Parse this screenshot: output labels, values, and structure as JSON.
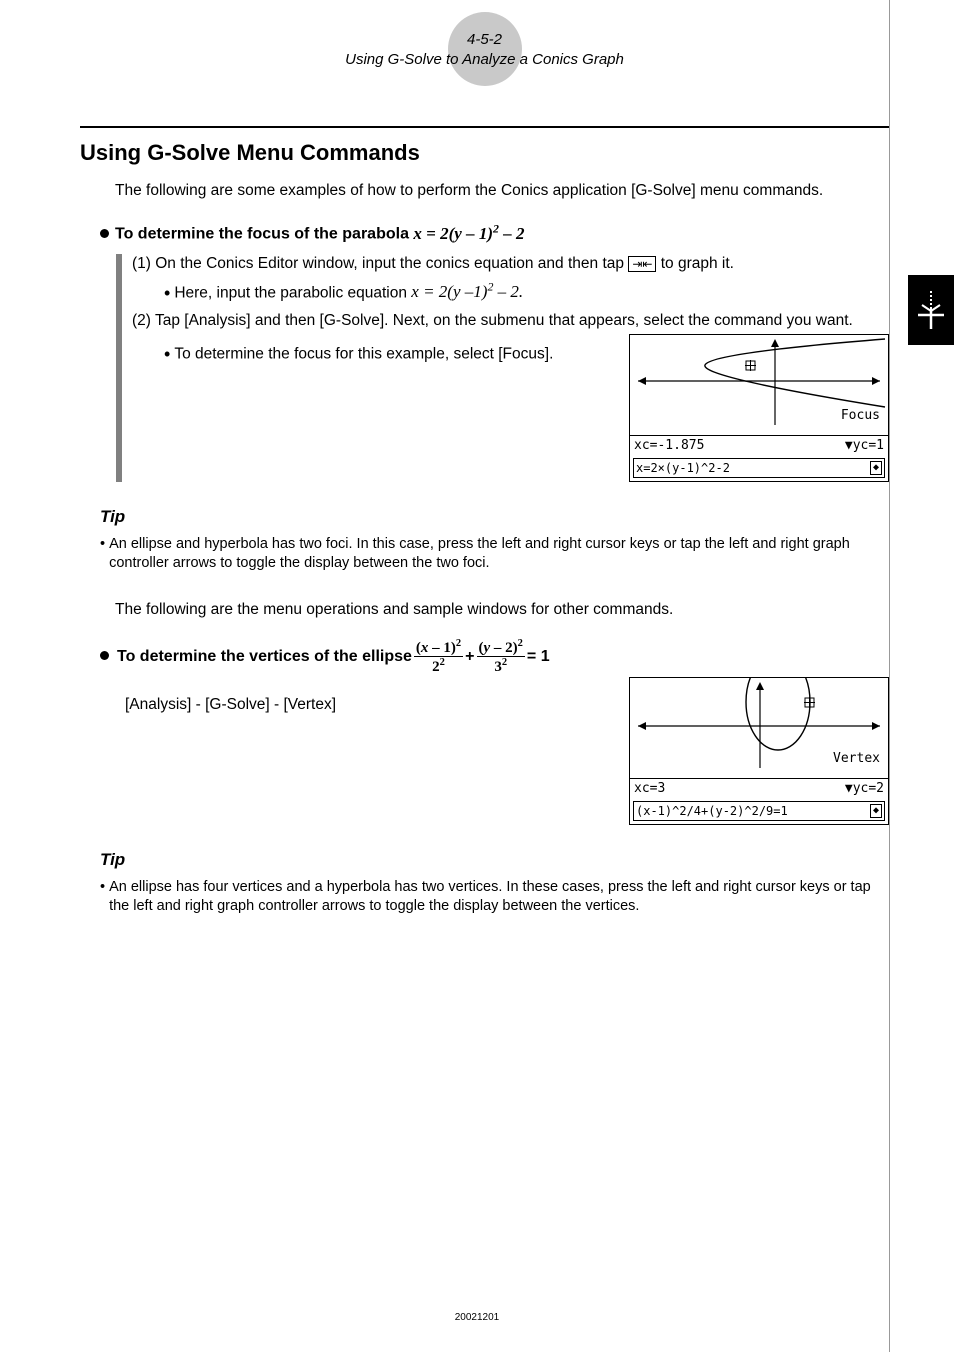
{
  "header": {
    "pagecode": "4-5-2",
    "subtitle": "Using G-Solve to Analyze a Conics Graph"
  },
  "section_title": "Using G-Solve Menu Commands",
  "intro": "The following are some examples of how to perform the Conics application [G-Solve] menu commands.",
  "ex1": {
    "heading_prefix": "To determine the focus of the parabola ",
    "heading_eq": "x = 2(y – 1)² – 2",
    "step1": "(1) On the Conics Editor window, input the conics equation and then tap ",
    "step1_suffix": " to graph it.",
    "step1_sub_prefix": "Here, input the parabolic equation ",
    "step1_sub_eq": "x = 2(y –1)² – 2.",
    "step2": "(2) Tap [Analysis] and then [G-Solve]. Next, on the submenu that appears, select the command you want.",
    "step2_sub": "To determine the focus for this example, select [Focus].",
    "screenshot": {
      "label": "Focus",
      "xc": "xc=-1.875",
      "yc": "yc=1",
      "eq": "x=2×(y-1)^2-2"
    }
  },
  "tip1": {
    "label": "Tip",
    "body": "An ellipse and hyperbola has two foci. In this case, press the left and right cursor keys or tap the left and right graph controller arrows to toggle the display between the two foci."
  },
  "between": "The following are the menu operations and sample windows for other commands.",
  "ex2": {
    "heading_prefix": "To determine the vertices of the ellipse  ",
    "frac1_num": "(x – 1)²",
    "frac1_den": "2²",
    "plus": " + ",
    "frac2_num": "(y – 2)²",
    "frac2_den": "3²",
    "eq_suffix": " = 1",
    "menupath": "[Analysis] - [G-Solve] - [Vertex]",
    "screenshot": {
      "label": "Vertex",
      "xc": "xc=3",
      "yc": "yc=2",
      "eq": "(x-1)^2/4+(y-2)^2/9=1"
    }
  },
  "tip2": {
    "label": "Tip",
    "body": "An ellipse has four vertices and a hyperbola has two vertices. In these cases, press the left and right cursor keys or tap the left and right graph controller arrows to toggle the display between the vertices."
  },
  "chart_data": [
    {
      "type": "parabola-horizontal-plot",
      "equation": "x = 2(y-1)^2 - 2",
      "solve": "Focus",
      "result": {
        "xc": -1.875,
        "yc": 1
      }
    },
    {
      "type": "ellipse-plot",
      "equation": "(x-1)^2/4 + (y-2)^2/9 = 1",
      "solve": "Vertex",
      "result": {
        "xc": 3,
        "yc": 2
      }
    }
  ],
  "footer_code": "20021201"
}
